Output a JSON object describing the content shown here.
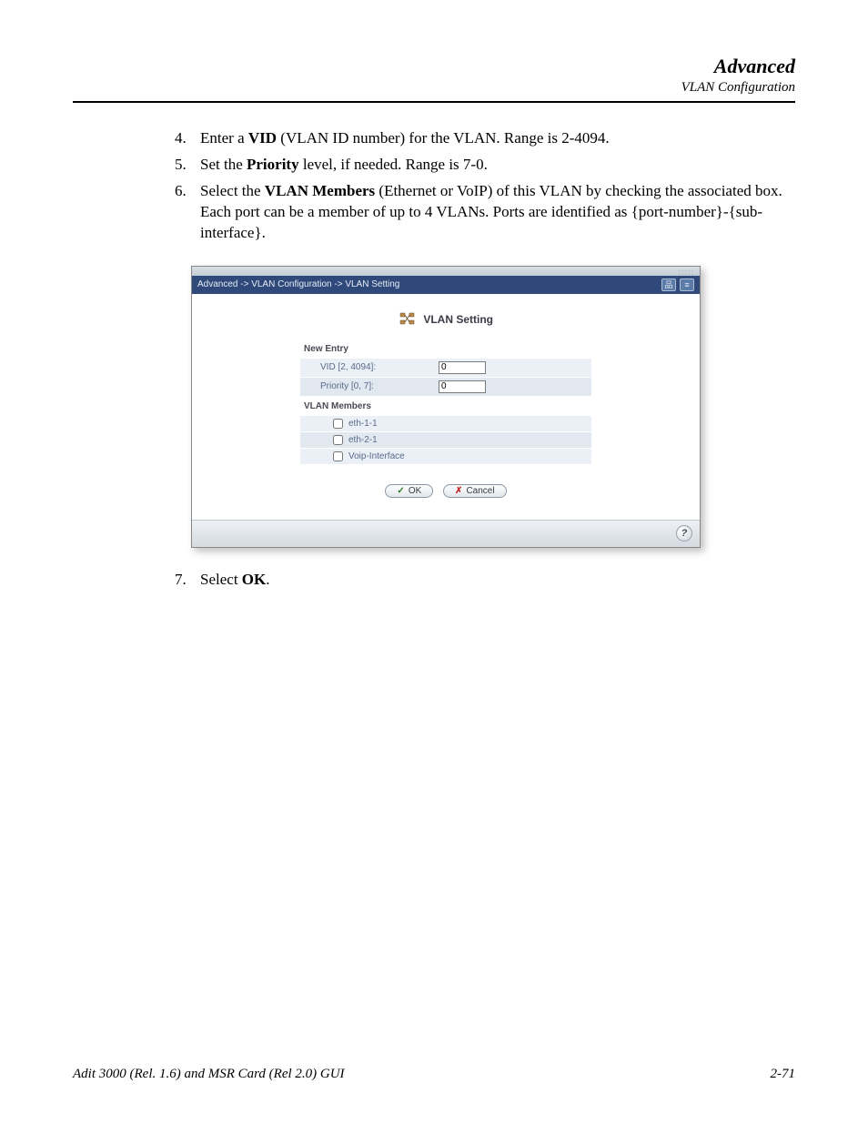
{
  "header": {
    "title": "Advanced",
    "subtitle": "VLAN Configuration"
  },
  "steps": [
    {
      "n": "4.",
      "pre": "Enter a ",
      "bold": "VID",
      "post": " (VLAN ID number) for the VLAN.  Range is 2-4094."
    },
    {
      "n": "5.",
      "pre": "Set the ",
      "bold": "Priority",
      "post": " level, if needed.  Range is 7-0."
    },
    {
      "n": "6.",
      "pre": "Select the ",
      "bold": "VLAN Members",
      "post": " (Ethernet or VoIP) of this VLAN by checking the associated box. Each port can be a member of up to 4 VLANs.  Ports are identified as {port-number}-{sub-interface}."
    }
  ],
  "after_step": {
    "n": "7.",
    "pre": "Select ",
    "bold": "OK",
    "post": "."
  },
  "shot": {
    "breadcrumb": "Advanced -> VLAN Configuration -> VLAN Setting",
    "title": "VLAN Setting",
    "group_new": "New Entry",
    "vid_label": "VID [2, 4094]:",
    "vid_value": "0",
    "priority_label": "Priority [0, 7]:",
    "priority_value": "0",
    "group_members": "VLAN Members",
    "members": [
      "eth-1-1",
      "eth-2-1",
      "Voip-Interface"
    ],
    "ok": "OK",
    "cancel": "Cancel"
  },
  "footer": {
    "left": "Adit 3000 (Rel. 1.6) and MSR Card (Rel 2.0) GUI",
    "right": "2-71"
  }
}
